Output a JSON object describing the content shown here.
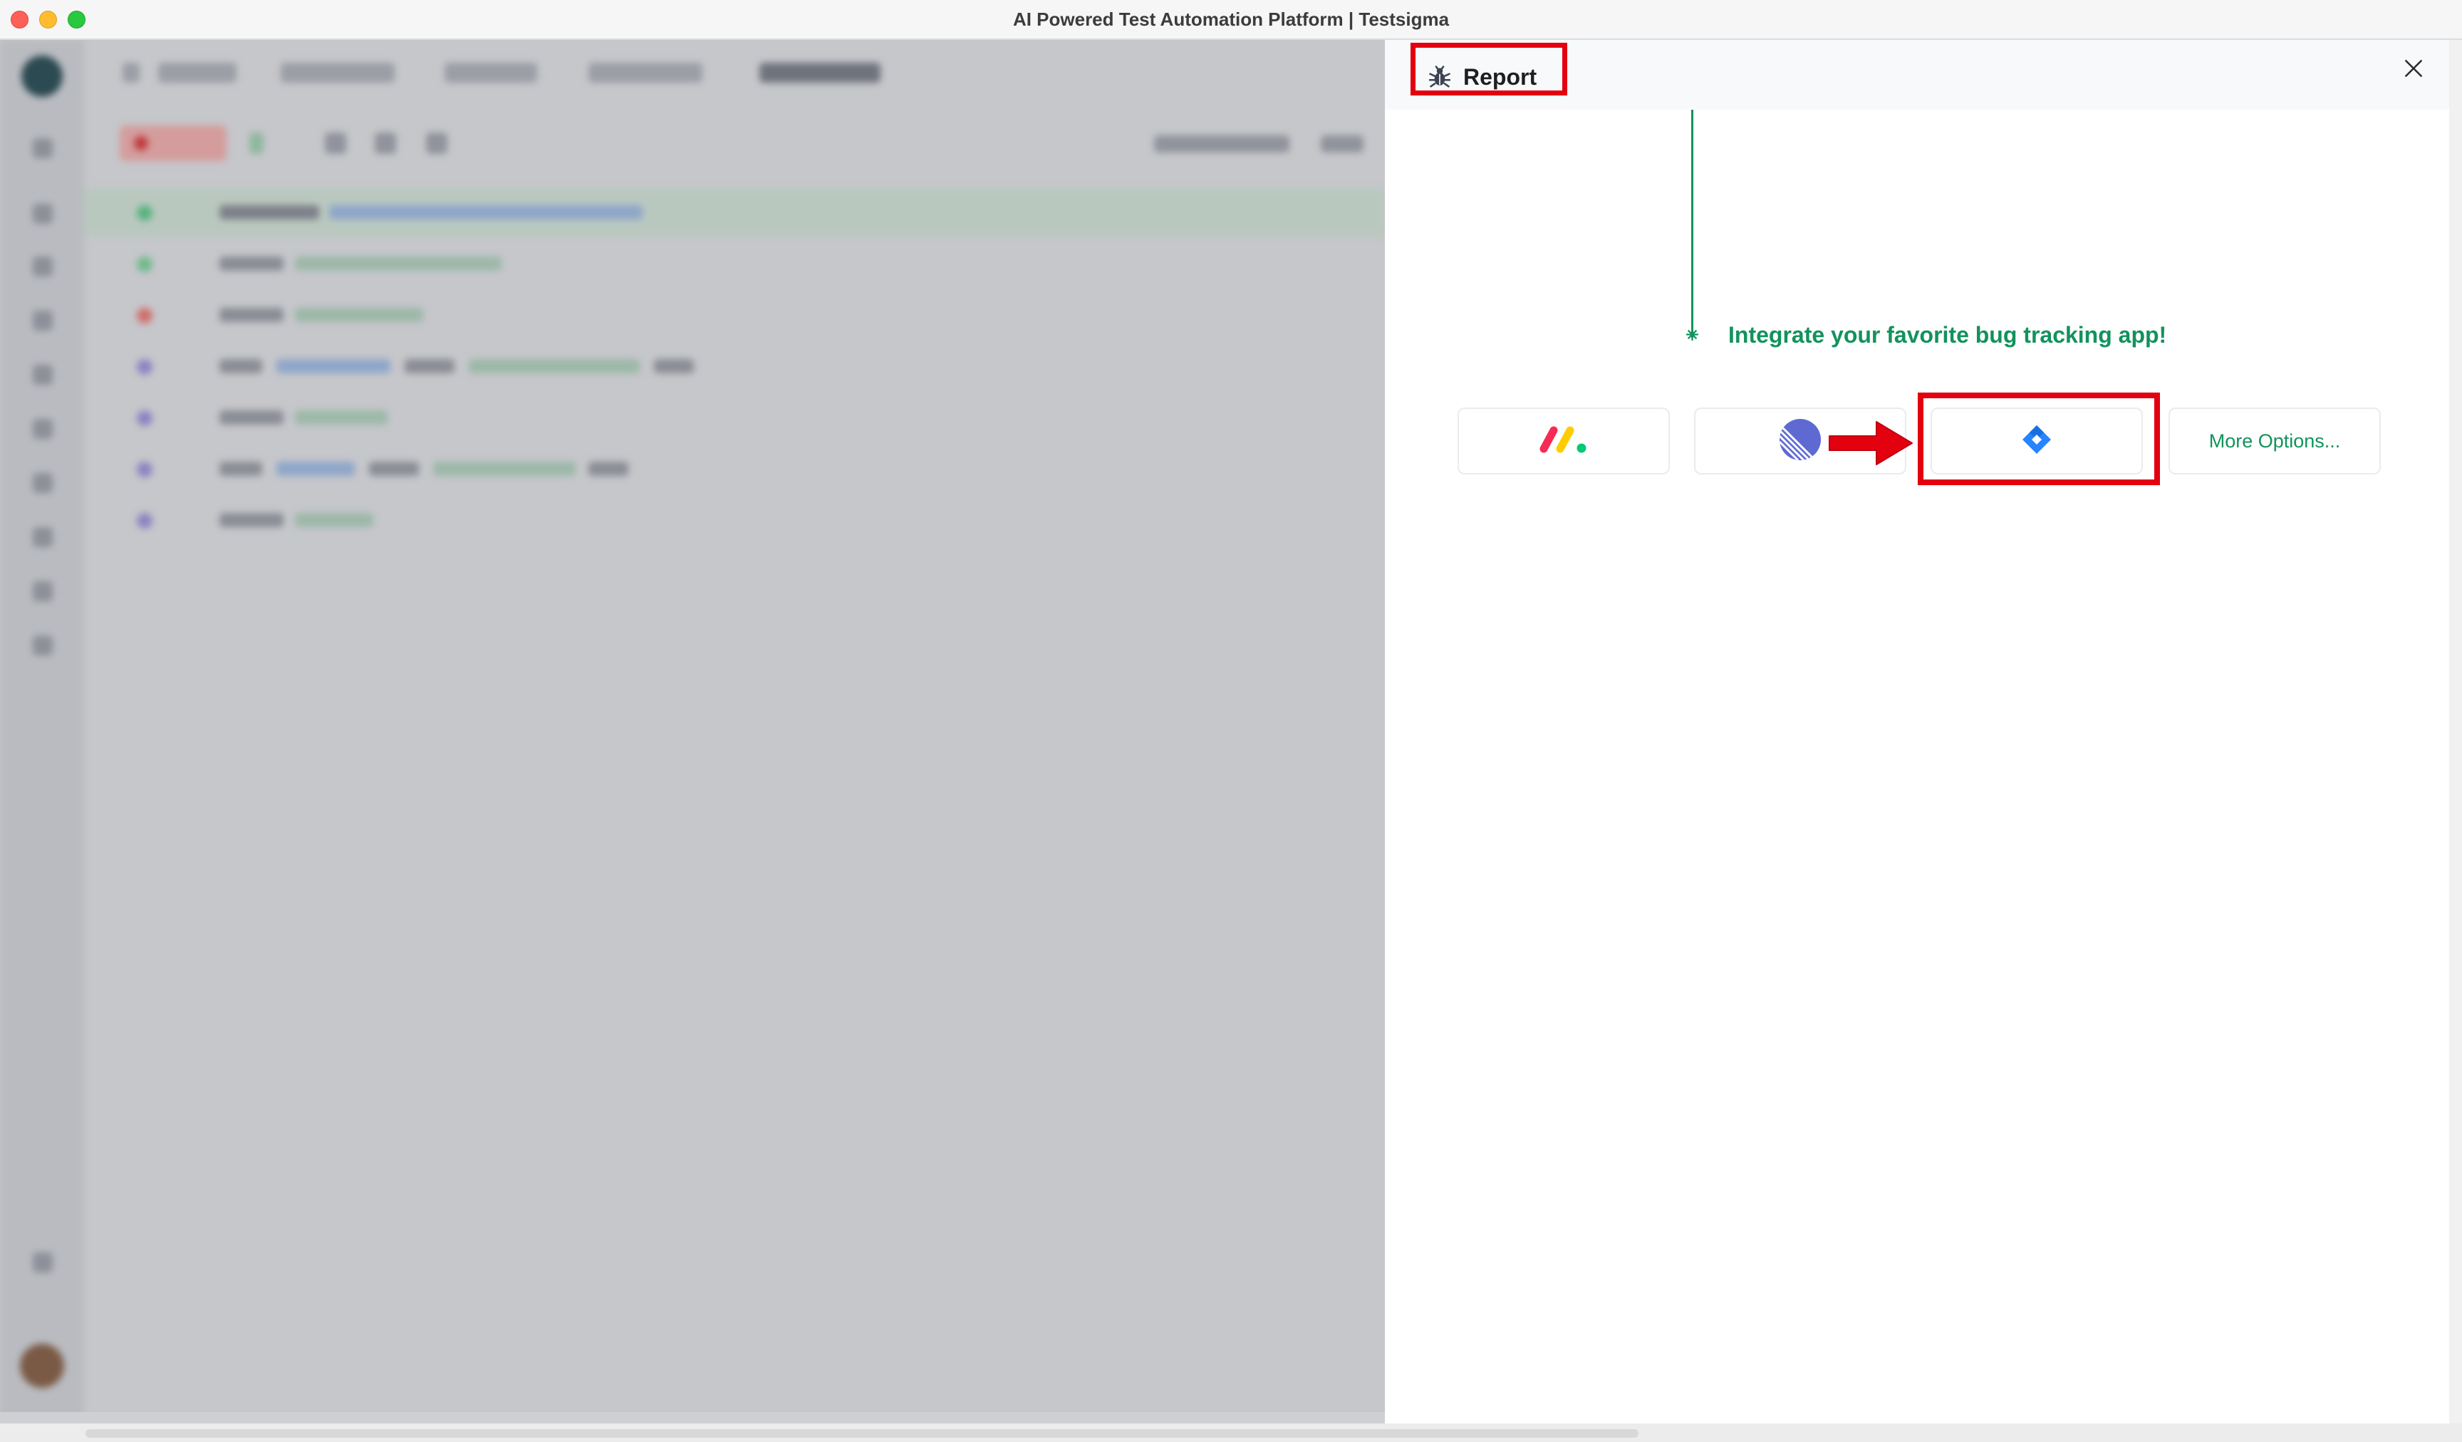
{
  "window": {
    "title": "AI Powered Test Automation Platform | Testsigma"
  },
  "panel": {
    "title": "Report",
    "icon": "bug-icon",
    "close_icon": "close-icon",
    "integrate_text": "Integrate your favorite bug tracking app!",
    "accent_color": "#11935c",
    "integrations": [
      {
        "name": "monday",
        "icon": "monday-logo-icon"
      },
      {
        "name": "linear",
        "icon": "linear-logo-icon"
      },
      {
        "name": "jira",
        "icon": "jira-logo-icon"
      },
      {
        "name": "more",
        "label": "More Options..."
      }
    ]
  },
  "annotations": {
    "highlight_color": "#e3000f"
  }
}
